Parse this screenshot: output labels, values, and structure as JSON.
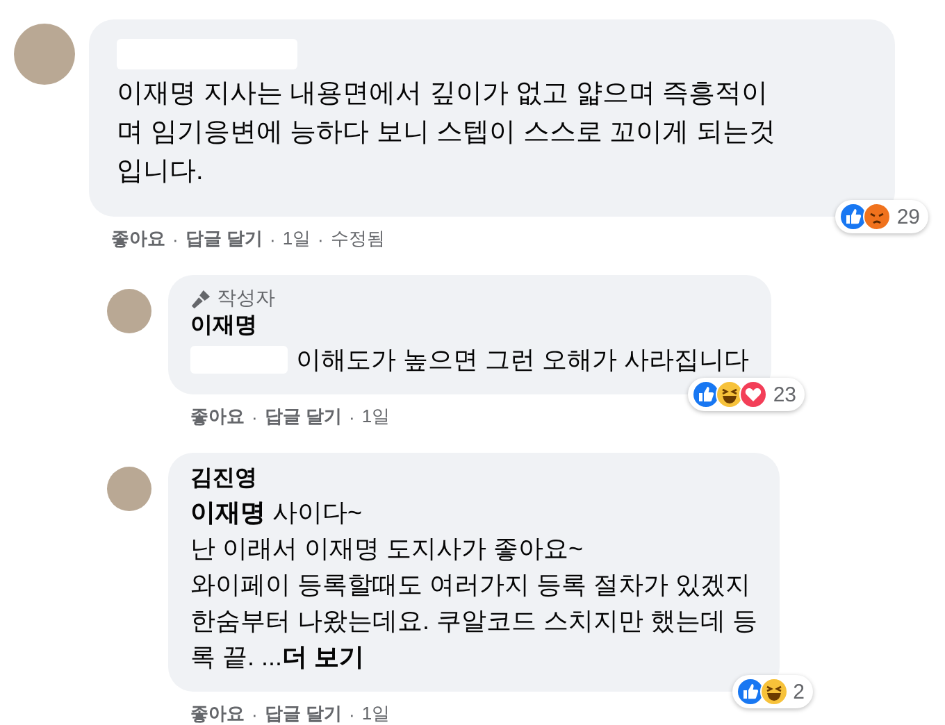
{
  "comments": [
    {
      "author_redacted": true,
      "body": "이재명 지사는 내용면에서 깊이가 없고 얇으며 즉흥적이\n며 임기응변에 능하다 보니 스텝이 스스로 꼬이게 되는것\n입니다.",
      "body_redacted_prefix": false,
      "reactions": [
        {
          "kind": "like"
        },
        {
          "kind": "angry"
        }
      ],
      "reaction_count": "29",
      "meta": [
        {
          "kind": "action",
          "text": "좋아요"
        },
        {
          "kind": "dot",
          "text": "·"
        },
        {
          "kind": "action",
          "text": "답글 달기"
        },
        {
          "kind": "dot",
          "text": "·"
        },
        {
          "kind": "time",
          "text": "1일"
        },
        {
          "kind": "dot",
          "text": "·"
        },
        {
          "kind": "note",
          "text": "수정됨"
        }
      ],
      "reply": false
    },
    {
      "author": "이재명",
      "author_redacted": false,
      "badge": "작성자",
      "body": "이해도가 높으면 그런 오해가 사라집니다",
      "body_redacted_prefix": true,
      "reactions": [
        {
          "kind": "like"
        },
        {
          "kind": "haha"
        },
        {
          "kind": "love"
        }
      ],
      "reaction_count": "23",
      "meta": [
        {
          "kind": "action",
          "text": "좋아요"
        },
        {
          "kind": "dot",
          "text": "·"
        },
        {
          "kind": "action",
          "text": "답글 달기"
        },
        {
          "kind": "dot",
          "text": "·"
        },
        {
          "kind": "time",
          "text": "1일"
        }
      ],
      "reply": true
    },
    {
      "author": "김진영",
      "author_redacted": false,
      "body": "**이재명** 사이다~\n난 이래서 이재명 도지사가 좋아요~\n와이페이 등록할때도 여러가지 등록 절차가 있겠지\n한숨부터 나왔는데요. 쿠알코드 스치지만 했는데 등\n록 끝. ...",
      "body_redacted_prefix": false,
      "see_more": "더 보기",
      "reactions": [
        {
          "kind": "like"
        },
        {
          "kind": "haha"
        }
      ],
      "reaction_count": "2",
      "meta": [
        {
          "kind": "action",
          "text": "좋아요"
        },
        {
          "kind": "dot",
          "text": "·"
        },
        {
          "kind": "action",
          "text": "답글 달기"
        },
        {
          "kind": "dot",
          "text": "·"
        },
        {
          "kind": "time",
          "text": "1일"
        }
      ],
      "reply": true
    }
  ]
}
